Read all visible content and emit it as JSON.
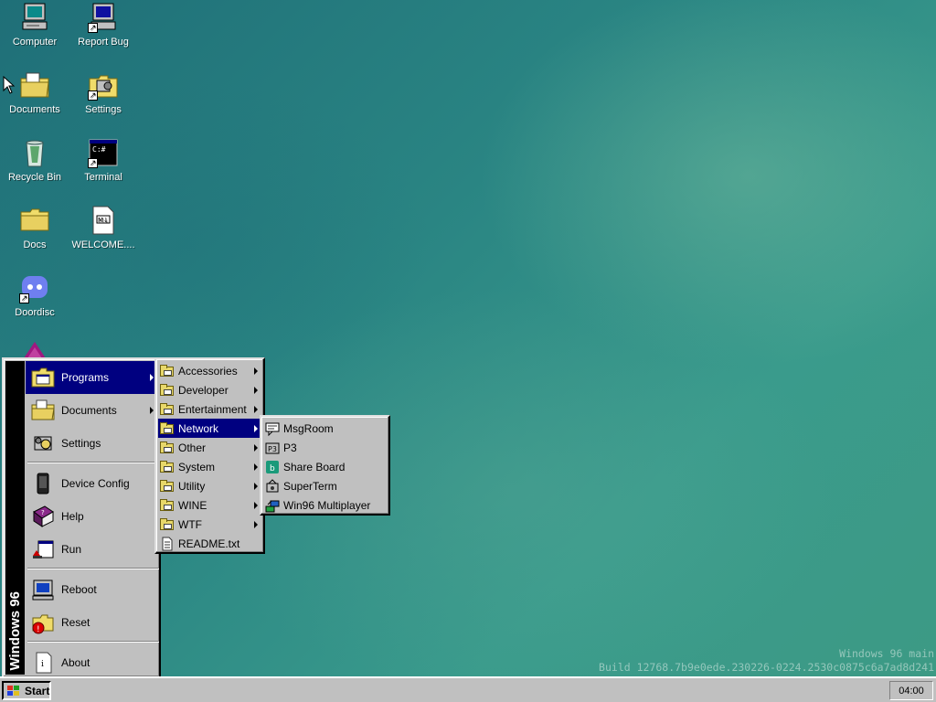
{
  "desktop": {
    "icons": [
      {
        "label": "Computer",
        "icon": "computer-icon"
      },
      {
        "label": "Report Bug",
        "icon": "report-bug-icon"
      },
      {
        "label": "Documents",
        "icon": "documents-folder-icon"
      },
      {
        "label": "Settings",
        "icon": "settings-icon"
      },
      {
        "label": "Recycle Bin",
        "icon": "recycle-bin-icon"
      },
      {
        "label": "Terminal",
        "icon": "terminal-icon"
      },
      {
        "label": "Docs",
        "icon": "folder-icon"
      },
      {
        "label": "WELCOME....",
        "icon": "markdown-file-icon"
      },
      {
        "label": "Doordisc",
        "icon": "doordisc-icon"
      }
    ],
    "watermark": {
      "line1": "Windows 96 main",
      "line2": "Build 12768.7b9e0ede.230226-0224.2530c0875c6a7ad8d241"
    }
  },
  "start_menu": {
    "sidebar_text": "Windows 96",
    "items": [
      {
        "label": "Programs",
        "icon": "programs-icon",
        "submenu": true,
        "active": true
      },
      {
        "label": "Documents",
        "icon": "documents-icon",
        "submenu": true
      },
      {
        "label": "Settings",
        "icon": "settings-icon"
      },
      {
        "label": "Device Config",
        "icon": "device-config-icon"
      },
      {
        "label": "Help",
        "icon": "help-book-icon"
      },
      {
        "label": "Run",
        "icon": "run-icon"
      },
      {
        "label": "Reboot",
        "icon": "reboot-icon"
      },
      {
        "label": "Reset",
        "icon": "reset-icon"
      },
      {
        "label": "About",
        "icon": "about-icon"
      }
    ]
  },
  "programs_menu": {
    "items": [
      {
        "label": "Accessories",
        "submenu": true
      },
      {
        "label": "Developer",
        "submenu": true
      },
      {
        "label": "Entertainment",
        "submenu": true
      },
      {
        "label": "Network",
        "submenu": true,
        "active": true
      },
      {
        "label": "Other",
        "submenu": true
      },
      {
        "label": "System",
        "submenu": true
      },
      {
        "label": "Utility",
        "submenu": true
      },
      {
        "label": "WINE",
        "submenu": true
      },
      {
        "label": "WTF",
        "submenu": true
      },
      {
        "label": "README.txt",
        "submenu": false
      }
    ]
  },
  "network_menu": {
    "items": [
      {
        "label": "MsgRoom",
        "icon": "chat-icon"
      },
      {
        "label": "P3",
        "icon": "p3-icon"
      },
      {
        "label": "Share Board",
        "icon": "share-board-icon"
      },
      {
        "label": "SuperTerm",
        "icon": "superterm-icon"
      },
      {
        "label": "Win96 Multiplayer",
        "icon": "multiplayer-icon"
      }
    ]
  },
  "taskbar": {
    "start_label": "Start",
    "clock": "04:00"
  },
  "colors": {
    "menu_bg": "#c0c0c0",
    "highlight": "#000080",
    "desktop": "#2a8583"
  }
}
